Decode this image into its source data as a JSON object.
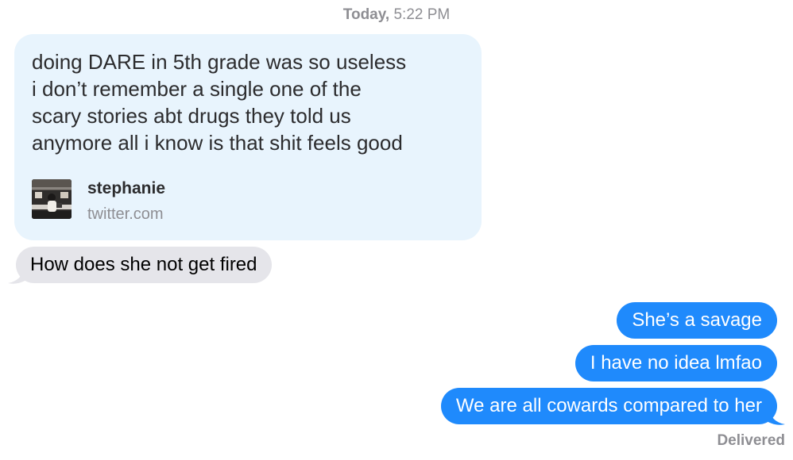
{
  "header": {
    "day": "Today,",
    "time": "5:22 PM"
  },
  "link_preview": {
    "quote_lines": [
      "doing DARE in 5th grade was so useless",
      "i don’t remember a single one of the",
      "scary stories abt drugs they told us",
      "anymore all i know is that shit feels good"
    ],
    "name": "stephanie",
    "domain": "twitter.com"
  },
  "received_messages": [
    {
      "text": "How does she not get fired"
    }
  ],
  "sent_messages": [
    {
      "text": "She’s a savage"
    },
    {
      "text": "I have no idea lmfao"
    },
    {
      "text": "We are all cowards compared to her"
    }
  ],
  "status": "Delivered",
  "colors": {
    "sent_bubble": "#1f8afc",
    "received_bubble": "#e5e5ea",
    "link_bubble": "#e8f4fd",
    "meta_text": "#8e8e93"
  }
}
